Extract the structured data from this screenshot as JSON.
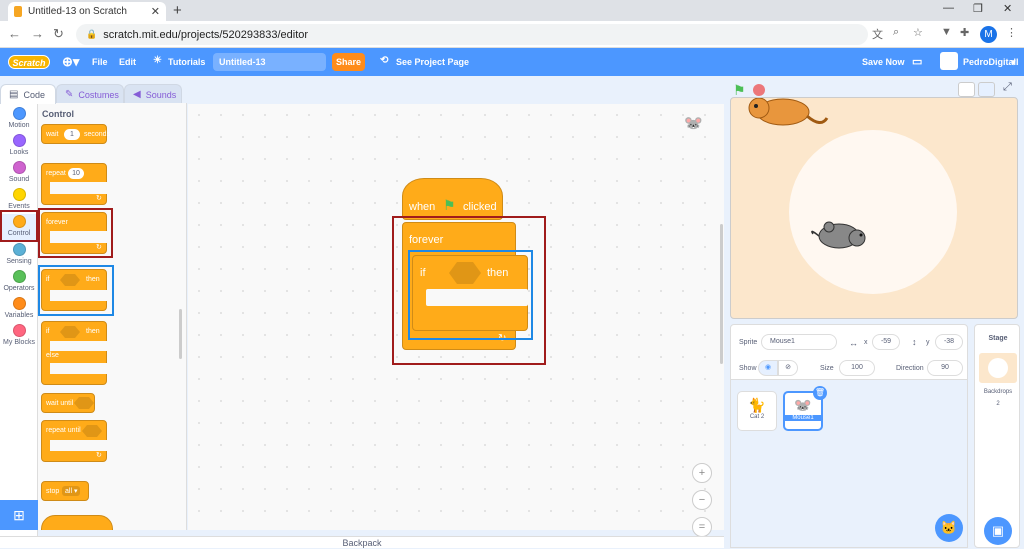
{
  "browser": {
    "tab_title": "Untitled-13 on Scratch",
    "url": "scratch.mit.edu/projects/520293833/editor",
    "profile_initial": "M"
  },
  "menu": {
    "logo": "Scratch",
    "file": "File",
    "edit": "Edit",
    "tutorials": "Tutorials",
    "project_title": "Untitled-13",
    "share": "Share",
    "see_project_page": "See Project Page",
    "save_now": "Save Now",
    "username": "PedroDigitall"
  },
  "tabs": {
    "code": "Code",
    "costumes": "Costumes",
    "sounds": "Sounds"
  },
  "categories": [
    {
      "label": "Motion",
      "color": "#4c97ff"
    },
    {
      "label": "Looks",
      "color": "#9966ff"
    },
    {
      "label": "Sound",
      "color": "#cf63cf"
    },
    {
      "label": "Events",
      "color": "#ffd500"
    },
    {
      "label": "Control",
      "color": "#ffab19"
    },
    {
      "label": "Sensing",
      "color": "#5cb1d6"
    },
    {
      "label": "Operators",
      "color": "#59c059"
    },
    {
      "label": "Variables",
      "color": "#ff8c1a"
    },
    {
      "label": "My Blocks",
      "color": "#ff6680"
    }
  ],
  "palette": {
    "heading": "Control",
    "wait": "wait",
    "wait_value": "1",
    "seconds": "seconds",
    "repeat": "repeat",
    "repeat_value": "10",
    "forever": "forever",
    "if": "if",
    "then": "then",
    "if2": "if",
    "then2": "then",
    "else": "else",
    "wait_until": "wait until",
    "repeat_until": "repeat until",
    "stop": "stop",
    "stop_value": "all ▾"
  },
  "script": {
    "when": "when",
    "clicked": "clicked",
    "forever": "forever",
    "if": "if",
    "then": "then"
  },
  "backpack": "Backpack",
  "sprite_info": {
    "sprite_label": "Sprite",
    "sprite_name": "Mouse1",
    "x_label": "x",
    "x": "-59",
    "y_label": "y",
    "y": "-38",
    "show_label": "Show",
    "size_label": "Size",
    "size": "100",
    "direction_label": "Direction",
    "direction": "90"
  },
  "sprites": [
    {
      "name": "Cat 2",
      "selected": false
    },
    {
      "name": "Mouse1",
      "selected": true
    }
  ],
  "stage_panel": {
    "title": "Stage",
    "backdrops_label": "Backdrops",
    "backdrops_count": "2"
  },
  "colors": {
    "menu_blue": "#4c97ff",
    "control_orange": "#ffab19",
    "highlight_red": "#a01c1c",
    "highlight_blue": "#1e88e5"
  }
}
